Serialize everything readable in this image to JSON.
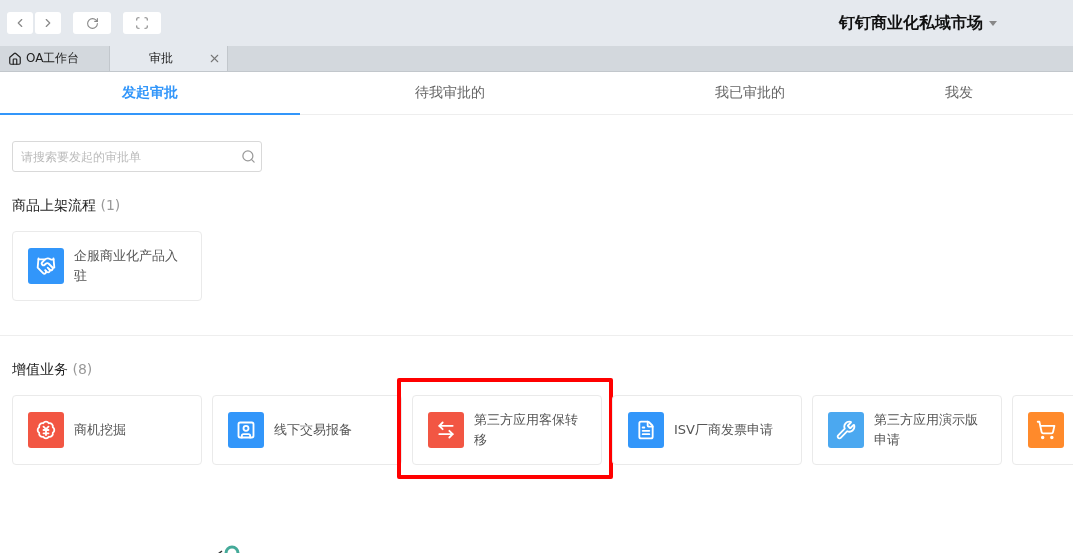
{
  "header": {
    "title": "钉钉商业化私域市场"
  },
  "window_tabs": [
    {
      "label": "OA工作台",
      "selected": false,
      "kind": "home"
    },
    {
      "label": "审批",
      "selected": true,
      "kind": "page"
    }
  ],
  "tabs": [
    {
      "label": "发起审批",
      "selected": true
    },
    {
      "label": "待我审批的",
      "selected": false
    },
    {
      "label": "我已审批的",
      "selected": false
    },
    {
      "label": "我发",
      "selected": false
    }
  ],
  "search": {
    "placeholder": "请搜索要发起的审批单"
  },
  "sections": [
    {
      "title": "商品上架流程",
      "count": "(1)",
      "items": [
        {
          "title": "企服商业化产品入驻",
          "kind": "handshake",
          "color": "#3296fa",
          "highlighted": false
        }
      ]
    },
    {
      "title": "增值业务",
      "count": "(8)",
      "items": [
        {
          "title": "商机挖掘",
          "kind": "moneybag",
          "color": "#f25643",
          "highlighted": false
        },
        {
          "title": "线下交易报备",
          "kind": "person",
          "color": "#3296fa",
          "highlighted": false
        },
        {
          "title": "第三方应用客保转移",
          "kind": "swap",
          "color": "#f25643",
          "highlighted": true
        },
        {
          "title": "ISV厂商发票申请",
          "kind": "document",
          "color": "#3296fa",
          "highlighted": false
        },
        {
          "title": "第三方应用演示版申请",
          "kind": "tools",
          "color": "#4ba8f0",
          "highlighted": false
        },
        {
          "kind": "cart",
          "color": "#ff8a2b",
          "highlighted": false
        }
      ]
    }
  ]
}
